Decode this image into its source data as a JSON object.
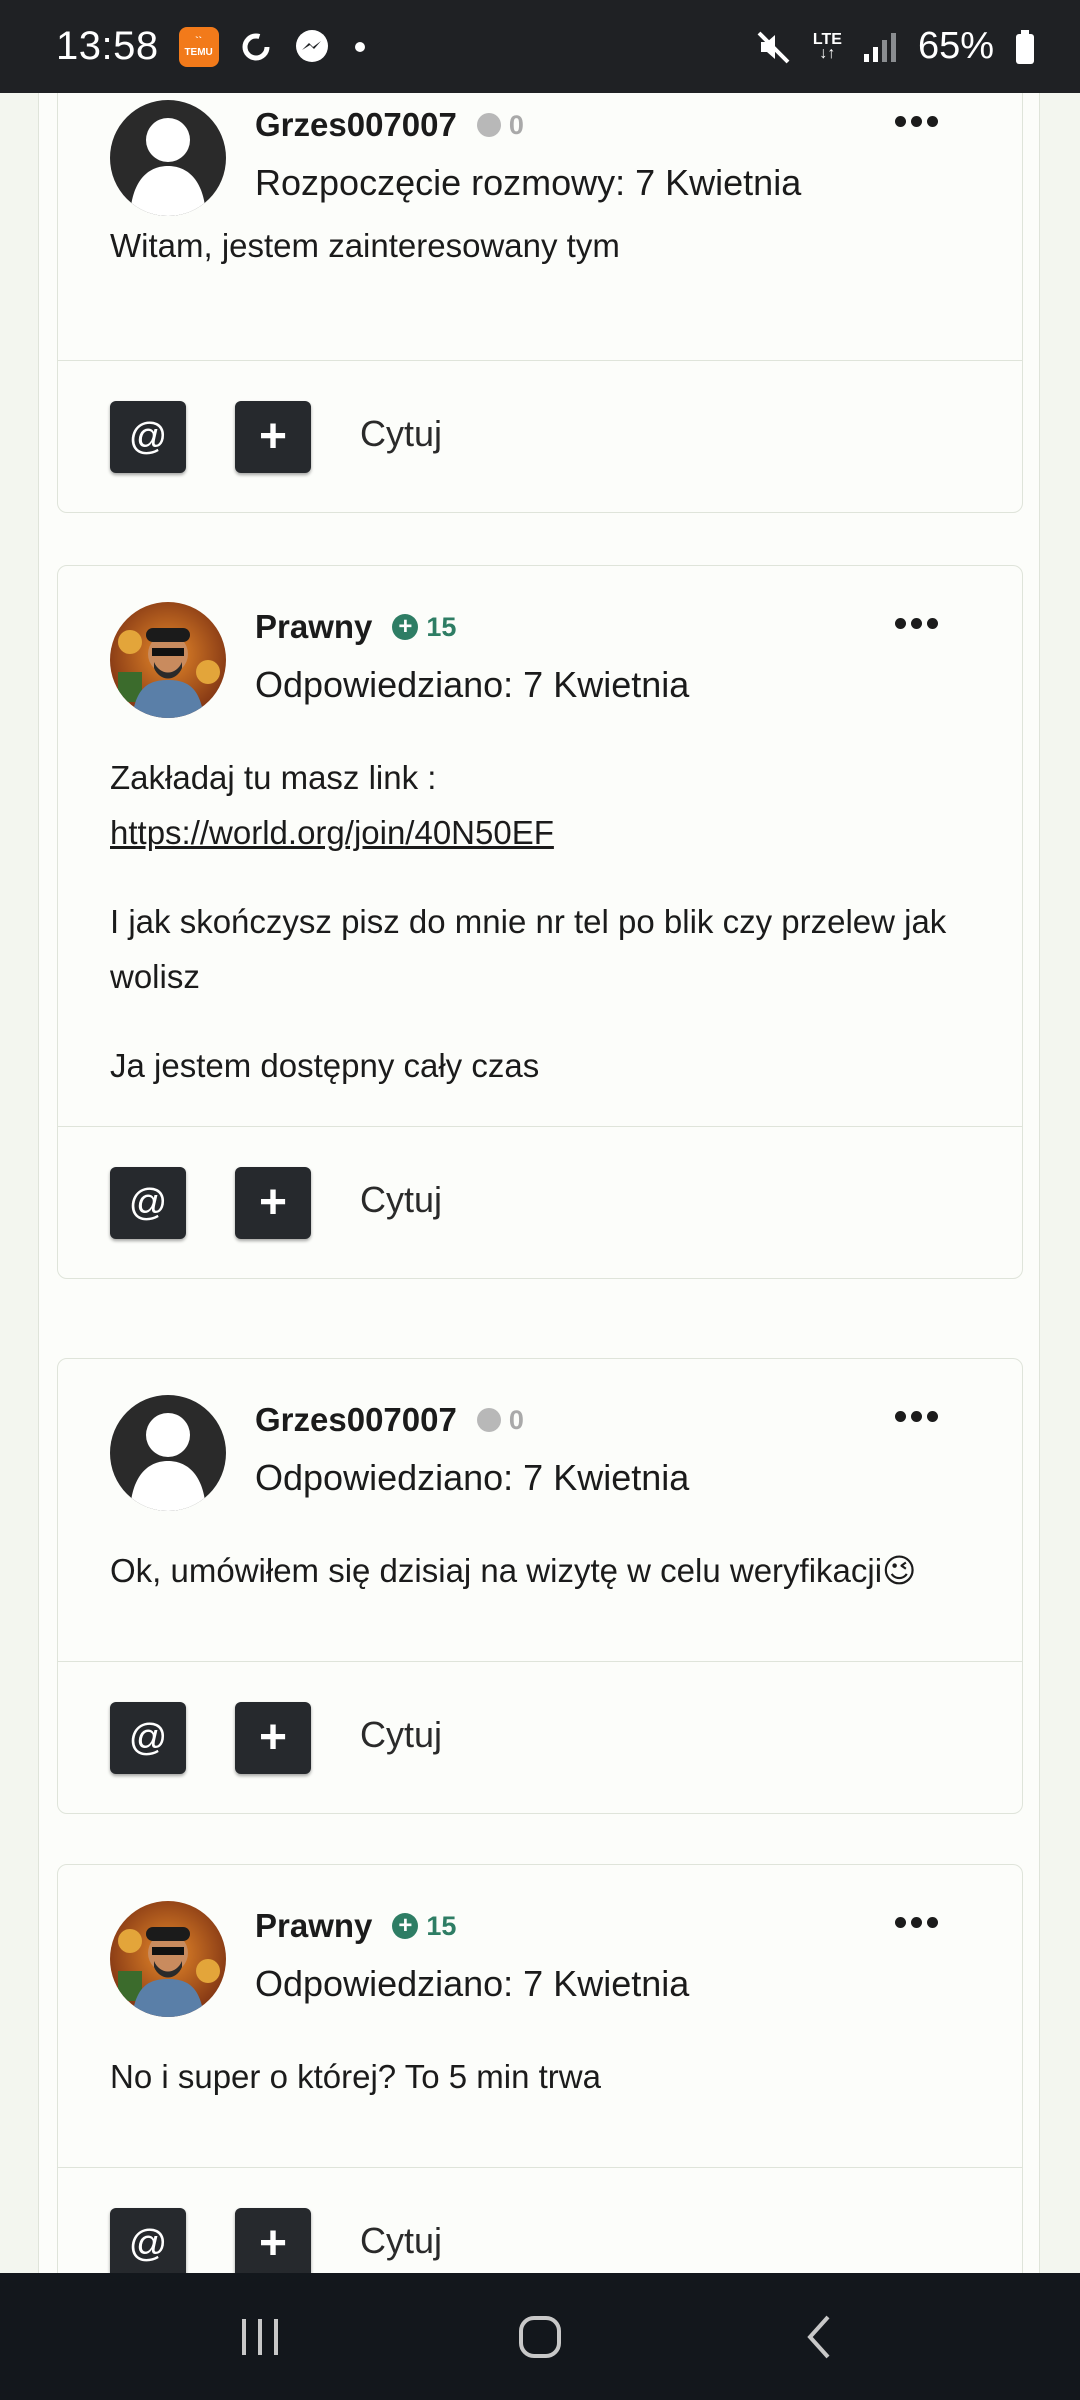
{
  "status_bar": {
    "time": "13:58",
    "temu_label_top": "``",
    "temu_label": "TEMU",
    "network": "LTE",
    "battery": "65%"
  },
  "colors": {
    "accent_positive": "#2e7d64",
    "button_dark": "#26292d"
  },
  "posts": [
    {
      "author": "Grzes007007",
      "reputation": "0",
      "reputation_type": "neutral",
      "date": "Rozpoczęcie rozmowy: 7 Kwietnia",
      "paragraphs": [
        "Witam, jestem zainteresowany tym"
      ],
      "mention_label": "@",
      "plus_label": "+",
      "quote_label": "Cytuj"
    },
    {
      "author": "Prawny",
      "reputation": "15",
      "reputation_type": "positive",
      "date": "Odpowiedziano: 7 Kwietnia",
      "paragraphs": [
        "Zakładaj tu masz link :",
        "I jak skończysz pisz do mnie nr tel po blik czy przelew jak wolisz",
        "Ja jestem dostępny cały czas"
      ],
      "link": "https://world.org/join/40N50EF",
      "mention_label": "@",
      "plus_label": "+",
      "quote_label": "Cytuj"
    },
    {
      "author": "Grzes007007",
      "reputation": "0",
      "reputation_type": "neutral",
      "date": "Odpowiedziano: 7 Kwietnia",
      "paragraphs": [
        "Ok, umówiłem się dzisiaj na wizytę w celu weryfikacji😉"
      ],
      "mention_label": "@",
      "plus_label": "+",
      "quote_label": "Cytuj"
    },
    {
      "author": "Prawny",
      "reputation": "15",
      "reputation_type": "positive",
      "date": "Odpowiedziano: 7 Kwietnia",
      "paragraphs": [
        "No i super o której? To 5 min trwa"
      ],
      "mention_label": "@",
      "plus_label": "+",
      "quote_label": "Cytuj"
    }
  ],
  "icons": {
    "more": "more-horizontal-icon",
    "recents": "recents-icon",
    "home": "home-icon",
    "back": "back-icon"
  }
}
